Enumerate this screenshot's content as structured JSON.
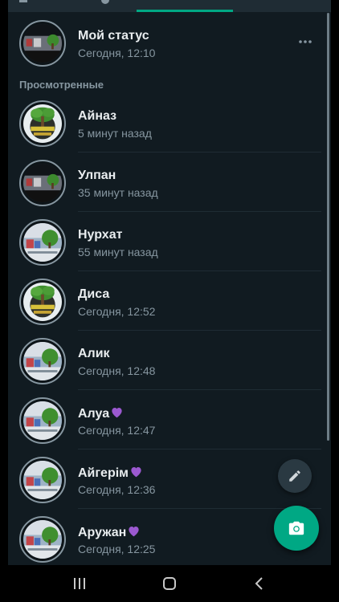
{
  "my_status": {
    "name": "Мой статус",
    "time": "Сегодня, 12:10"
  },
  "section_viewed": "Просмотренные",
  "contacts": [
    {
      "name": "Айназ",
      "time": "5 минут назад",
      "pic": "tree"
    },
    {
      "name": "Улпан",
      "time": "35 минут назад",
      "pic": "cluttered"
    },
    {
      "name": "Нурхат",
      "time": "55 минут назад",
      "pic": "landscape"
    },
    {
      "name": "Диса",
      "time": "Сегодня, 12:52",
      "pic": "tree"
    },
    {
      "name": "Алик",
      "time": "Сегодня, 12:48",
      "pic": "landscape"
    },
    {
      "name": "Алуа",
      "time": "Сегодня, 12:47",
      "pic": "landscape",
      "heart": true
    },
    {
      "name": "Айгерім",
      "time": "Сегодня, 12:36",
      "pic": "landscape",
      "heart": true
    },
    {
      "name": "Аружан",
      "time": "Сегодня, 12:25",
      "pic": "landscape",
      "heart": true
    }
  ],
  "icons": {
    "more": "more-vert-icon",
    "pencil": "pencil-icon",
    "camera": "camera-icon",
    "nav_recent": "recent-apps-icon",
    "nav_home": "home-icon",
    "nav_back": "back-icon"
  },
  "colors": {
    "background": "#111b21",
    "accent": "#00a884",
    "secondary_text": "#8696a0",
    "heart": "#9b59d0"
  }
}
